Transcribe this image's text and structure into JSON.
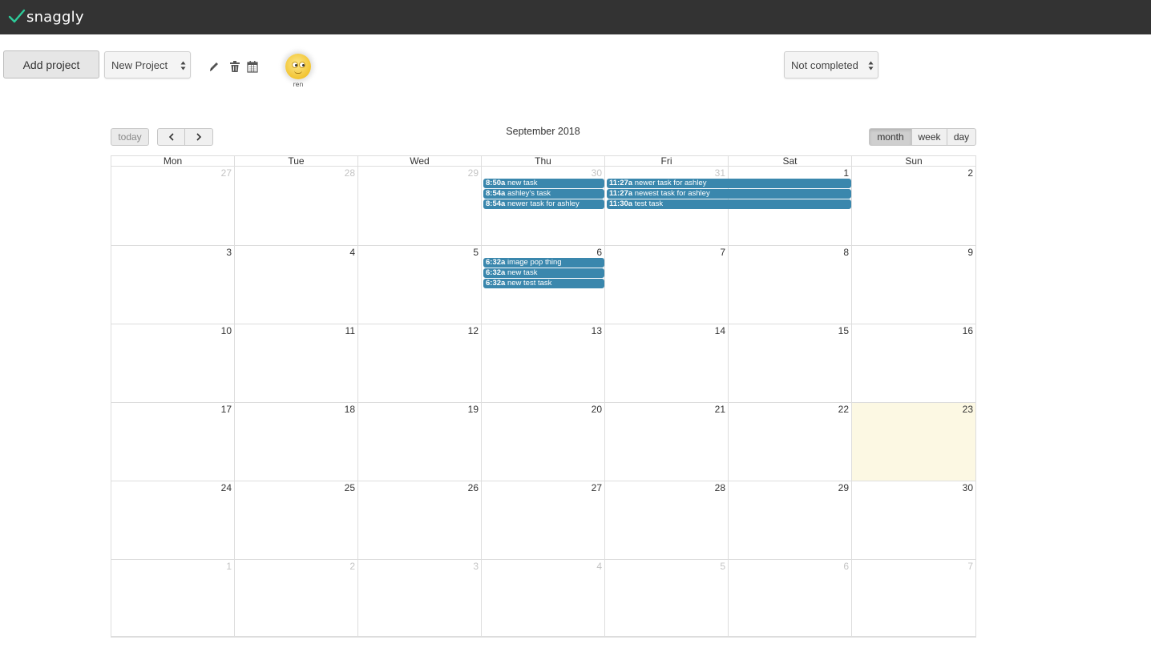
{
  "app": {
    "name": "snaggly",
    "brand_color": "#3a87ad",
    "check_color": "#2ecc9a"
  },
  "toolbar": {
    "add_project_label": "Add project",
    "project_select": "New Project",
    "status_select": "Not completed",
    "icons": [
      "edit-icon",
      "trash-icon",
      "calendar-icon"
    ]
  },
  "user": {
    "name": "ren",
    "avatar": "smiley-avatar"
  },
  "calendar": {
    "title": "September 2018",
    "today_label": "today",
    "views": {
      "month": "month",
      "week": "week",
      "day": "day"
    },
    "active_view": "month",
    "dow": [
      "Mon",
      "Tue",
      "Wed",
      "Thu",
      "Fri",
      "Sat",
      "Sun"
    ],
    "weeks": [
      [
        {
          "n": "27",
          "o": true
        },
        {
          "n": "28",
          "o": true
        },
        {
          "n": "29",
          "o": true
        },
        {
          "n": "30",
          "o": true
        },
        {
          "n": "31",
          "o": true
        },
        {
          "n": "1"
        },
        {
          "n": "2"
        }
      ],
      [
        {
          "n": "3"
        },
        {
          "n": "4"
        },
        {
          "n": "5"
        },
        {
          "n": "6"
        },
        {
          "n": "7"
        },
        {
          "n": "8"
        },
        {
          "n": "9"
        }
      ],
      [
        {
          "n": "10"
        },
        {
          "n": "11"
        },
        {
          "n": "12"
        },
        {
          "n": "13"
        },
        {
          "n": "14"
        },
        {
          "n": "15"
        },
        {
          "n": "16"
        }
      ],
      [
        {
          "n": "17"
        },
        {
          "n": "18"
        },
        {
          "n": "19"
        },
        {
          "n": "20"
        },
        {
          "n": "21"
        },
        {
          "n": "22"
        },
        {
          "n": "23",
          "today": true
        }
      ],
      [
        {
          "n": "24"
        },
        {
          "n": "25"
        },
        {
          "n": "26"
        },
        {
          "n": "27"
        },
        {
          "n": "28"
        },
        {
          "n": "29"
        },
        {
          "n": "30"
        }
      ],
      [
        {
          "n": "1",
          "o": true
        },
        {
          "n": "2",
          "o": true
        },
        {
          "n": "3",
          "o": true
        },
        {
          "n": "4",
          "o": true
        },
        {
          "n": "5",
          "o": true
        },
        {
          "n": "6",
          "o": true
        },
        {
          "n": "7",
          "o": true
        }
      ]
    ],
    "events": [
      {
        "week": 0,
        "start": 3,
        "span": 1,
        "slot": 0,
        "time": "8:50a",
        "title": "new task"
      },
      {
        "week": 0,
        "start": 3,
        "span": 1,
        "slot": 1,
        "time": "8:54a",
        "title": "ashley's task"
      },
      {
        "week": 0,
        "start": 3,
        "span": 1,
        "slot": 2,
        "time": "8:54a",
        "title": "newer task for ashley"
      },
      {
        "week": 0,
        "start": 4,
        "span": 2,
        "slot": 0,
        "time": "11:27a",
        "title": "newer task for ashley"
      },
      {
        "week": 0,
        "start": 4,
        "span": 2,
        "slot": 1,
        "time": "11:27a",
        "title": "newest task for ashley"
      },
      {
        "week": 0,
        "start": 4,
        "span": 2,
        "slot": 2,
        "time": "11:30a",
        "title": "test task"
      },
      {
        "week": 1,
        "start": 3,
        "span": 1,
        "slot": 0,
        "time": "6:32a",
        "title": "image pop thing"
      },
      {
        "week": 1,
        "start": 3,
        "span": 1,
        "slot": 1,
        "time": "6:32a",
        "title": "new task"
      },
      {
        "week": 1,
        "start": 3,
        "span": 1,
        "slot": 2,
        "time": "6:32a",
        "title": "new test task"
      }
    ]
  }
}
